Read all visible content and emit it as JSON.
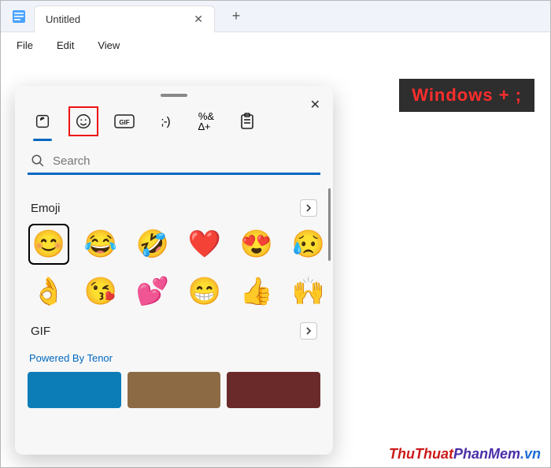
{
  "window": {
    "tab_title": "Untitled"
  },
  "menubar": {
    "items": [
      "File",
      "Edit",
      "View"
    ]
  },
  "hotkey": "Windows +  ;",
  "watermark": {
    "p1": "ThuThuat",
    "p2": "PhanMem",
    "p3": ".vn"
  },
  "picker": {
    "categories": [
      "recent",
      "emoji",
      "gif",
      "kaomoji",
      "symbols",
      "clipboard"
    ],
    "active_category": "recent",
    "highlighted_category": "emoji",
    "search_placeholder": "Search",
    "sections": {
      "emoji": {
        "title": "Emoji",
        "items": [
          {
            "glyph": "😊",
            "name": "smiling-face-smiling-eyes",
            "selected": true
          },
          {
            "glyph": "😂",
            "name": "face-tears-of-joy"
          },
          {
            "glyph": "🤣",
            "name": "rolling-on-floor-laughing"
          },
          {
            "glyph": "❤️",
            "name": "red-heart"
          },
          {
            "glyph": "😍",
            "name": "smiling-face-heart-eyes"
          },
          {
            "glyph": "😥",
            "name": "sad-but-relieved-face"
          },
          {
            "glyph": "👌",
            "name": "ok-hand"
          },
          {
            "glyph": "😘",
            "name": "face-blowing-kiss"
          },
          {
            "glyph": "💕",
            "name": "two-hearts"
          },
          {
            "glyph": "😁",
            "name": "beaming-face"
          },
          {
            "glyph": "👍",
            "name": "thumbs-up"
          },
          {
            "glyph": "🙌",
            "name": "raising-hands"
          }
        ]
      },
      "gif": {
        "title": "GIF",
        "powered_by": "Powered By Tenor",
        "thumbs": [
          {
            "color": "#0d7db8"
          },
          {
            "color": "#8c6b44"
          },
          {
            "color": "#6b2a2a"
          }
        ]
      }
    }
  }
}
